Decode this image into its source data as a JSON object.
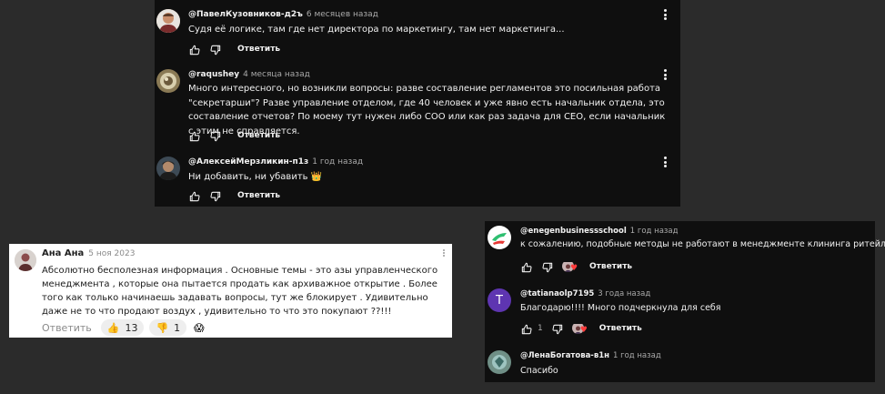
{
  "panel_a": {
    "reply_label": "Ответить",
    "comments": [
      {
        "author": "@ПавелКузовников-д2ъ",
        "time": "6 месяцев назад",
        "text": "Судя её логике, там где нет директора по маркетингу, там нет маркетинга..."
      },
      {
        "author": "@raqushey",
        "time": "4 месяца назад",
        "text": "Много интересного, но возникли вопросы: разве составление регламентов это посильная работа \"секретарши\"? Разве управление отделом, где 40 человек и уже явно есть начальник отдела, это составление отчетов? По моему тут нужен либо СОО или как раз задача для СЕО, если начальник с этим не справляется."
      },
      {
        "author": "@АлексейМерзликин-п1з",
        "time": "1 год назад",
        "text": "Ни добавить, ни убавить 👑"
      }
    ]
  },
  "panel_b": {
    "author": "Ана Ана",
    "time": "5 ноя 2023",
    "text": "Абсолютно бесполезная информация . Основные темы - это азы управленческого менеджмента , которые она пытается продать как архиважное открытие . Более того как только начинаешь задавать вопросы, тут же блокирует . Удивительно даже не то что продают воздух , удивительно то что это покупают ??!!!",
    "reply_label": "Ответить",
    "reactions": [
      {
        "emoji": "👍",
        "count": "13"
      },
      {
        "emoji": "👎",
        "count": "1"
      }
    ],
    "extra_reaction": "😱"
  },
  "panel_c": {
    "reply_label": "Ответить",
    "comments": [
      {
        "author": "@enegenbusinessschool",
        "time": "1 год назад",
        "text": "к сожалению, подобные методы не работают в менеджменте клининга ритейла",
        "likes": ""
      },
      {
        "author": "@tatianaolp7195",
        "time": "3 года назад",
        "text": "Благодарю!!!! Много подчеркнула для себя",
        "likes": "1",
        "avatar_letter": "T"
      },
      {
        "author": "@ЛенаБогатова-в1н",
        "time": "1 год назад",
        "text": "Спасибо",
        "likes": ""
      }
    ]
  },
  "colors": {
    "dark_bg": "#0f0f0f",
    "page_bg": "#2b2b2b",
    "text_light": "#f1f1f1",
    "text_muted": "#aaaaaa",
    "heart": "#ff3b3b",
    "avatar_t": "#5e35b1"
  },
  "icons": [
    "thumb-up-icon",
    "thumb-down-icon",
    "more-vert-icon",
    "heart-icon"
  ]
}
